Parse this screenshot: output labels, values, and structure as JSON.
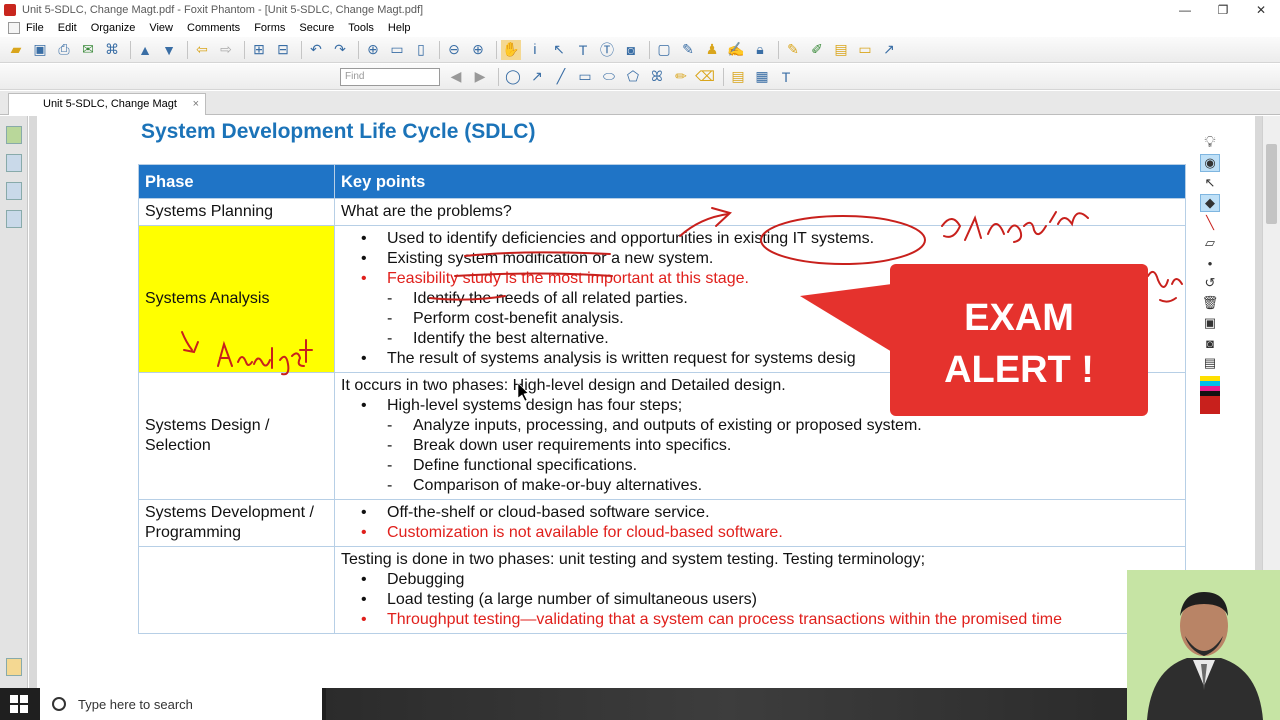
{
  "window": {
    "title": "Unit 5-SDLC, Change Magt.pdf - Foxit Phantom - [Unit 5-SDLC, Change Magt.pdf]",
    "minimize": "—",
    "restore": "❐",
    "close": "✕"
  },
  "menu": [
    "File",
    "Edit",
    "Organize",
    "View",
    "Comments",
    "Forms",
    "Secure",
    "Tools",
    "Help"
  ],
  "toolbar2": {
    "find_placeholder": "Find"
  },
  "tab": {
    "label": "Unit 5-SDLC, Change Magt",
    "close": "×"
  },
  "slide": {
    "title": "System Development Life Cycle (SDLC)",
    "headers": {
      "phase": "Phase",
      "key_points": "Key points"
    },
    "rows": {
      "planning": {
        "phase": "Systems Planning",
        "text": "What are the problems?"
      },
      "analysis": {
        "phase": "Systems Analysis",
        "b1": "Used to identify deficiencies and opportunities in existing IT systems.",
        "b2": "Existing system modification or a new system.",
        "b3": "Feasibility study is the most important at this stage.",
        "d1": "Identify the needs of all related parties.",
        "d2": "Perform cost-benefit analysis.",
        "d3": "Identify the best alternative.",
        "b4": "The result of systems analysis is written request for systems desig"
      },
      "design": {
        "phase": "Systems Design / Selection",
        "intro": "It occurs in two phases: High-level design and Detailed design.",
        "b1": "High-level systems design has four steps;",
        "d1": "Analyze inputs, processing, and outputs of existing or proposed system.",
        "d2": "Break down user requirements into specifics.",
        "d3": "Define functional specifications.",
        "d4": "Comparison of make-or-buy alternatives."
      },
      "development": {
        "phase": "Systems Development / Programming",
        "b1": "Off-the-shelf or cloud-based software service.",
        "b2": "Customization is not available for cloud-based software."
      },
      "testing": {
        "phase": "",
        "intro": "Testing is done in two phases: unit testing and system testing. Testing terminology;",
        "b1": "Debugging",
        "b2": "Load testing (a large number of simultaneous users)",
        "b3": "Throughput testing—validating that a system can process transactions within the promised time"
      }
    }
  },
  "callout": {
    "line1": "EXAM",
    "line2": "ALERT !"
  },
  "taskbar": {
    "search_placeholder": "Type here to search"
  },
  "colors": {
    "header_blue": "#1f74c6",
    "title_blue": "#1b73b8",
    "highlight": "#ffff00",
    "red_text": "#e0201c",
    "alert_red": "#e5322d",
    "ink": "#c8201c"
  }
}
